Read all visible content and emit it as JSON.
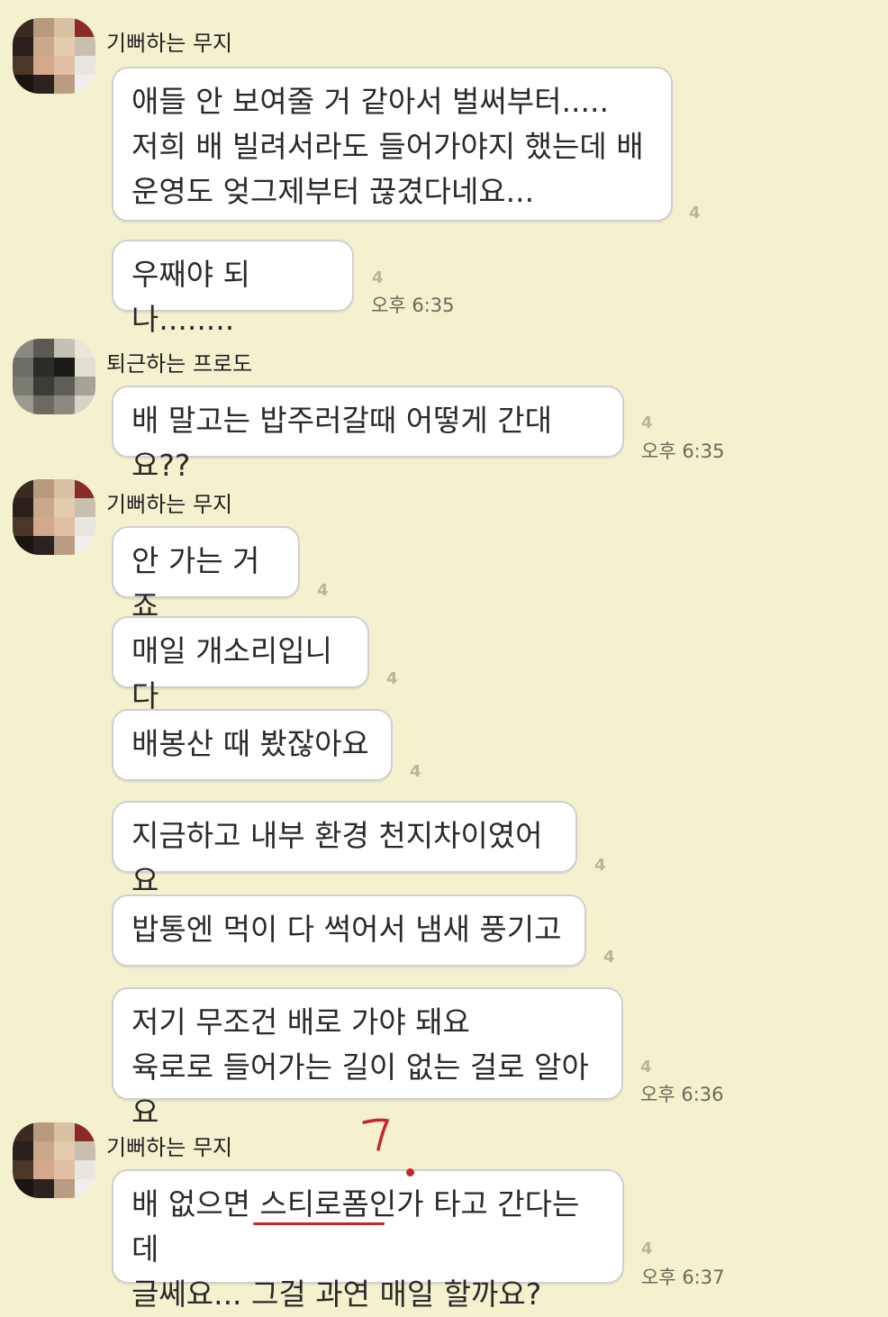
{
  "groups": [
    {
      "sender": "기뻐하는 무지",
      "messages": [
        {
          "text": "애들 안 보여줄 거 같아서 벌써부터.....\n저희 배 빌려서라도 들어가야지 했는데 배\n운영도 엊그제부터 끊겼다네요...",
          "unread": "4",
          "time": ""
        },
        {
          "text": "우째야 되나........",
          "unread": "4",
          "time": "오후 6:35"
        }
      ]
    },
    {
      "sender": "퇴근하는 프로도",
      "messages": [
        {
          "text": "배 말고는 밥주러갈때 어떻게 간대요??",
          "unread": "4",
          "time": "오후 6:35"
        }
      ]
    },
    {
      "sender": "기뻐하는 무지",
      "messages": [
        {
          "text": "안 가는 거죠",
          "unread": "4",
          "time": ""
        },
        {
          "text": "매일 개소리입니다",
          "unread": "4",
          "time": ""
        },
        {
          "text": "배봉산 때 봤잖아요",
          "unread": "4",
          "time": ""
        },
        {
          "text": "지금하고 내부 환경 천지차이였어요",
          "unread": "4",
          "time": ""
        },
        {
          "text": "밥통엔 먹이 다 썩어서 냄새 풍기고",
          "unread": "4",
          "time": ""
        },
        {
          "text": "저기 무조건 배로 가야 돼요\n육로로 들어가는 길이 없는 걸로 알아요",
          "unread": "4",
          "time": "오후 6:36"
        }
      ]
    },
    {
      "sender": "기뻐하는 무지",
      "messages": [
        {
          "text": "배 없으면 스티로폼인가 타고 간다는데\n글쎄요... 그걸 과연 매일 할까요?",
          "unread": "4",
          "time": "오후 6:37"
        }
      ]
    }
  ],
  "colors": {
    "background": "#f4f1cf",
    "bubble": "#ffffff",
    "bubble_border": "#cfcfcf",
    "unread": "#b8b59a",
    "annotation_red": "#c8262c"
  },
  "icons": [
    "avatar-muzi",
    "avatar-frodo"
  ]
}
